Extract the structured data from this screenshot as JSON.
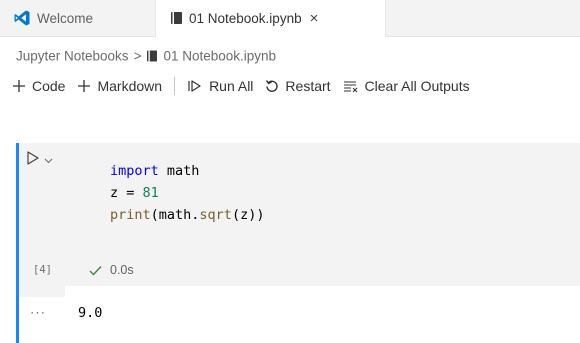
{
  "tabs": [
    {
      "label": "Welcome",
      "icon": "vscode-logo-icon",
      "active": false
    },
    {
      "label": "01 Notebook.ipynb",
      "icon": "notebook-icon",
      "active": true,
      "close": "×"
    }
  ],
  "breadcrumb": {
    "root": "Jupyter Notebooks",
    "separator": ">",
    "file": "01 Notebook.ipynb"
  },
  "toolbar": {
    "code_label": "Code",
    "markdown_label": "Markdown",
    "run_all_label": "Run All",
    "restart_label": "Restart",
    "clear_outputs_label": "Clear All Outputs"
  },
  "cell": {
    "code_lines": [
      {
        "kw": "import",
        "rest": " math"
      },
      {
        "text": "z = ",
        "num": "81"
      },
      {
        "fn": "print",
        "p1": "(math.",
        "fn2": "sqrt",
        "p2": "(z))"
      }
    ],
    "execution_count": "[4]",
    "status_time": "0.0s",
    "output_more": "···",
    "output": "9.0"
  },
  "colors": {
    "accent": "#1a85ff",
    "keyword": "#0000ff",
    "number": "#098658",
    "function": "#795e26",
    "success": "#388a34"
  }
}
